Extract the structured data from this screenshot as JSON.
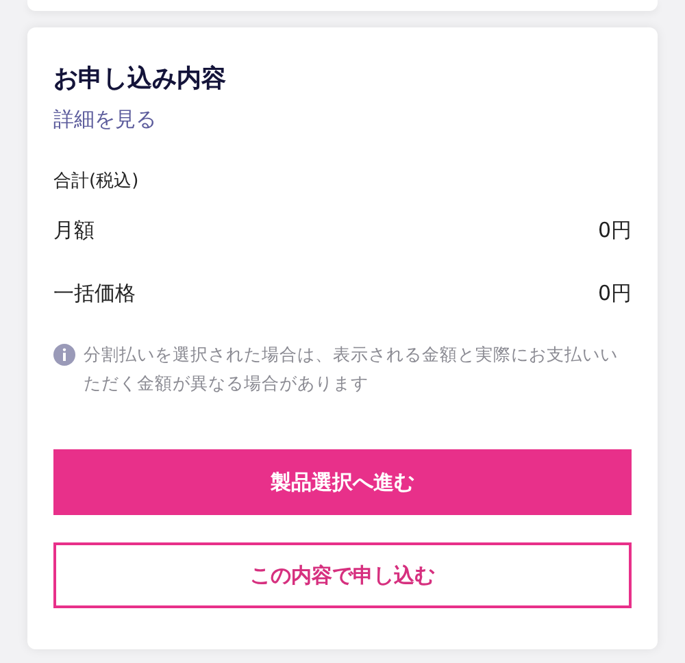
{
  "summary": {
    "title": "お申し込み内容",
    "details_link": "詳細を見る",
    "total_label": "合計(税込)",
    "rows": [
      {
        "label": "月額",
        "value": "0円"
      },
      {
        "label": "一括価格",
        "value": "0円"
      }
    ],
    "note": "分割払いを選択された場合は、表示される金額と実際にお支払いいただく金額が異なる場合があります",
    "buttons": [
      {
        "kind": "primary",
        "label": "製品選択へ進む"
      },
      {
        "kind": "secondary",
        "label": "この内容で申し込む"
      }
    ]
  }
}
